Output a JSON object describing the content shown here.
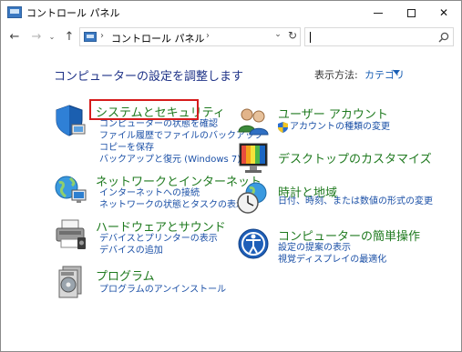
{
  "window": {
    "title": "コントロール パネル",
    "min_glyph": "—",
    "close_glyph": "✕"
  },
  "nav": {
    "back_glyph": "←",
    "forward_glyph": "→",
    "recent_glyph": "⌄",
    "up_glyph": "↑",
    "breadcrumb_sep": "›",
    "breadcrumb_location": "コントロール パネル",
    "dropdown_glyph": "⌄",
    "refresh_glyph": "↻",
    "search_value": ""
  },
  "content": {
    "heading": "コンピューターの設定を調整します",
    "view_by_label": "表示方法:",
    "view_by_value": "カテゴリ"
  },
  "categories": [
    {
      "title": "システムとセキュリティ",
      "links": [
        "コンピューターの状態を確認",
        "ファイル履歴でファイルのバックアップ",
        "コピーを保存",
        "バックアップと復元 (Windows 7)"
      ]
    },
    {
      "title": "ネットワークとインターネット",
      "links": [
        "インターネットへの接続",
        "ネットワークの状態とタスクの表示"
      ]
    },
    {
      "title": "ハードウェアとサウンド",
      "links": [
        "デバイスとプリンターの表示",
        "デバイスの追加"
      ]
    },
    {
      "title": "プログラム",
      "links": [
        "プログラムのアンインストール"
      ]
    },
    {
      "title": "ユーザー アカウント",
      "links": [
        "アカウントの種類の変更"
      ]
    },
    {
      "title": "デスクトップのカスタマイズ",
      "links": []
    },
    {
      "title": "時計と地域",
      "links": [
        "日付、時刻、または数値の形式の変更"
      ]
    },
    {
      "title": "コンピューターの簡単操作",
      "links": [
        "設定の提案の表示",
        "視覚ディスプレイの最適化"
      ]
    }
  ],
  "colors": {
    "heading": "#1e3287",
    "category_title": "#1f7a1f",
    "link": "#1a4fa6",
    "highlight_border": "#d61b1b"
  }
}
